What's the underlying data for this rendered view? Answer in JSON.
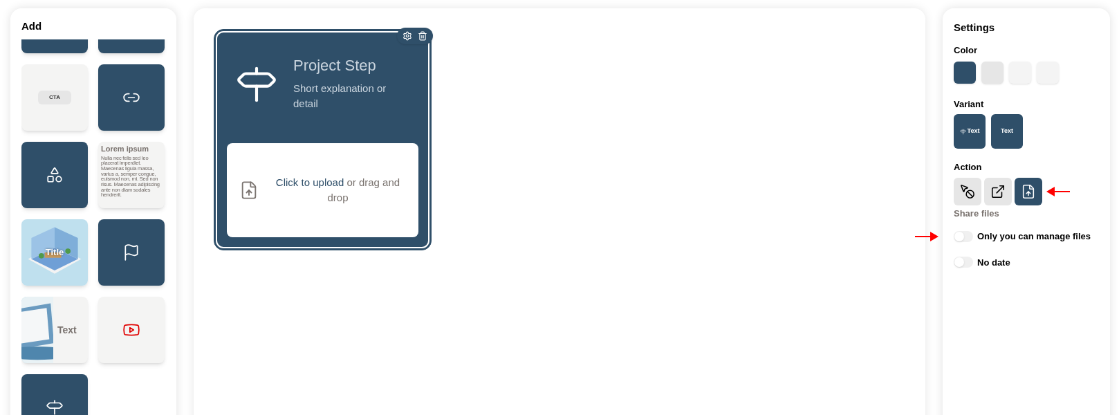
{
  "add_panel": {
    "title": "Add",
    "tiles": [
      {
        "kind": "blank"
      },
      {
        "kind": "blank"
      },
      {
        "kind": "cta",
        "text": "CTA"
      },
      {
        "kind": "link"
      },
      {
        "kind": "shapes"
      },
      {
        "kind": "lorem",
        "title": "Lorem ipsum",
        "text": "Nulla nec felis sed leo placerat imperdiet. Maecenas ligula massa, varius a, semper congue, euismod non, mi. Sed non risus. Maecenas adipiscing ante non diam sodales hendrerit."
      },
      {
        "kind": "image_title",
        "text": "Title"
      },
      {
        "kind": "flag"
      },
      {
        "kind": "image_text",
        "text": "Text"
      },
      {
        "kind": "video"
      },
      {
        "kind": "signpost"
      }
    ]
  },
  "canvas": {
    "card": {
      "title": "Project Step",
      "subtitle": "Short explanation or detail",
      "upload_link": "Click to upload",
      "upload_text": " or drag and drop"
    }
  },
  "settings": {
    "title": "Settings",
    "color_label": "Color",
    "colors": [
      {
        "color": "#2f4f69"
      },
      {
        "color": "#e6e6e6"
      },
      {
        "color": "#f4f4f4"
      },
      {
        "color": "#f4f4f4"
      }
    ],
    "variant_label": "Variant",
    "variants": [
      {
        "text": "Text",
        "kind": "icon_text"
      },
      {
        "text": "Text",
        "kind": "text"
      }
    ],
    "action_label": "Action",
    "actions": [
      {
        "selected": false
      },
      {
        "selected": false
      },
      {
        "selected": true
      }
    ],
    "action_caption": "Share files",
    "toggles": [
      {
        "label": "Only you can manage files",
        "on": false,
        "arrow": true
      },
      {
        "label": "No date",
        "on": false,
        "arrow": false
      }
    ]
  }
}
